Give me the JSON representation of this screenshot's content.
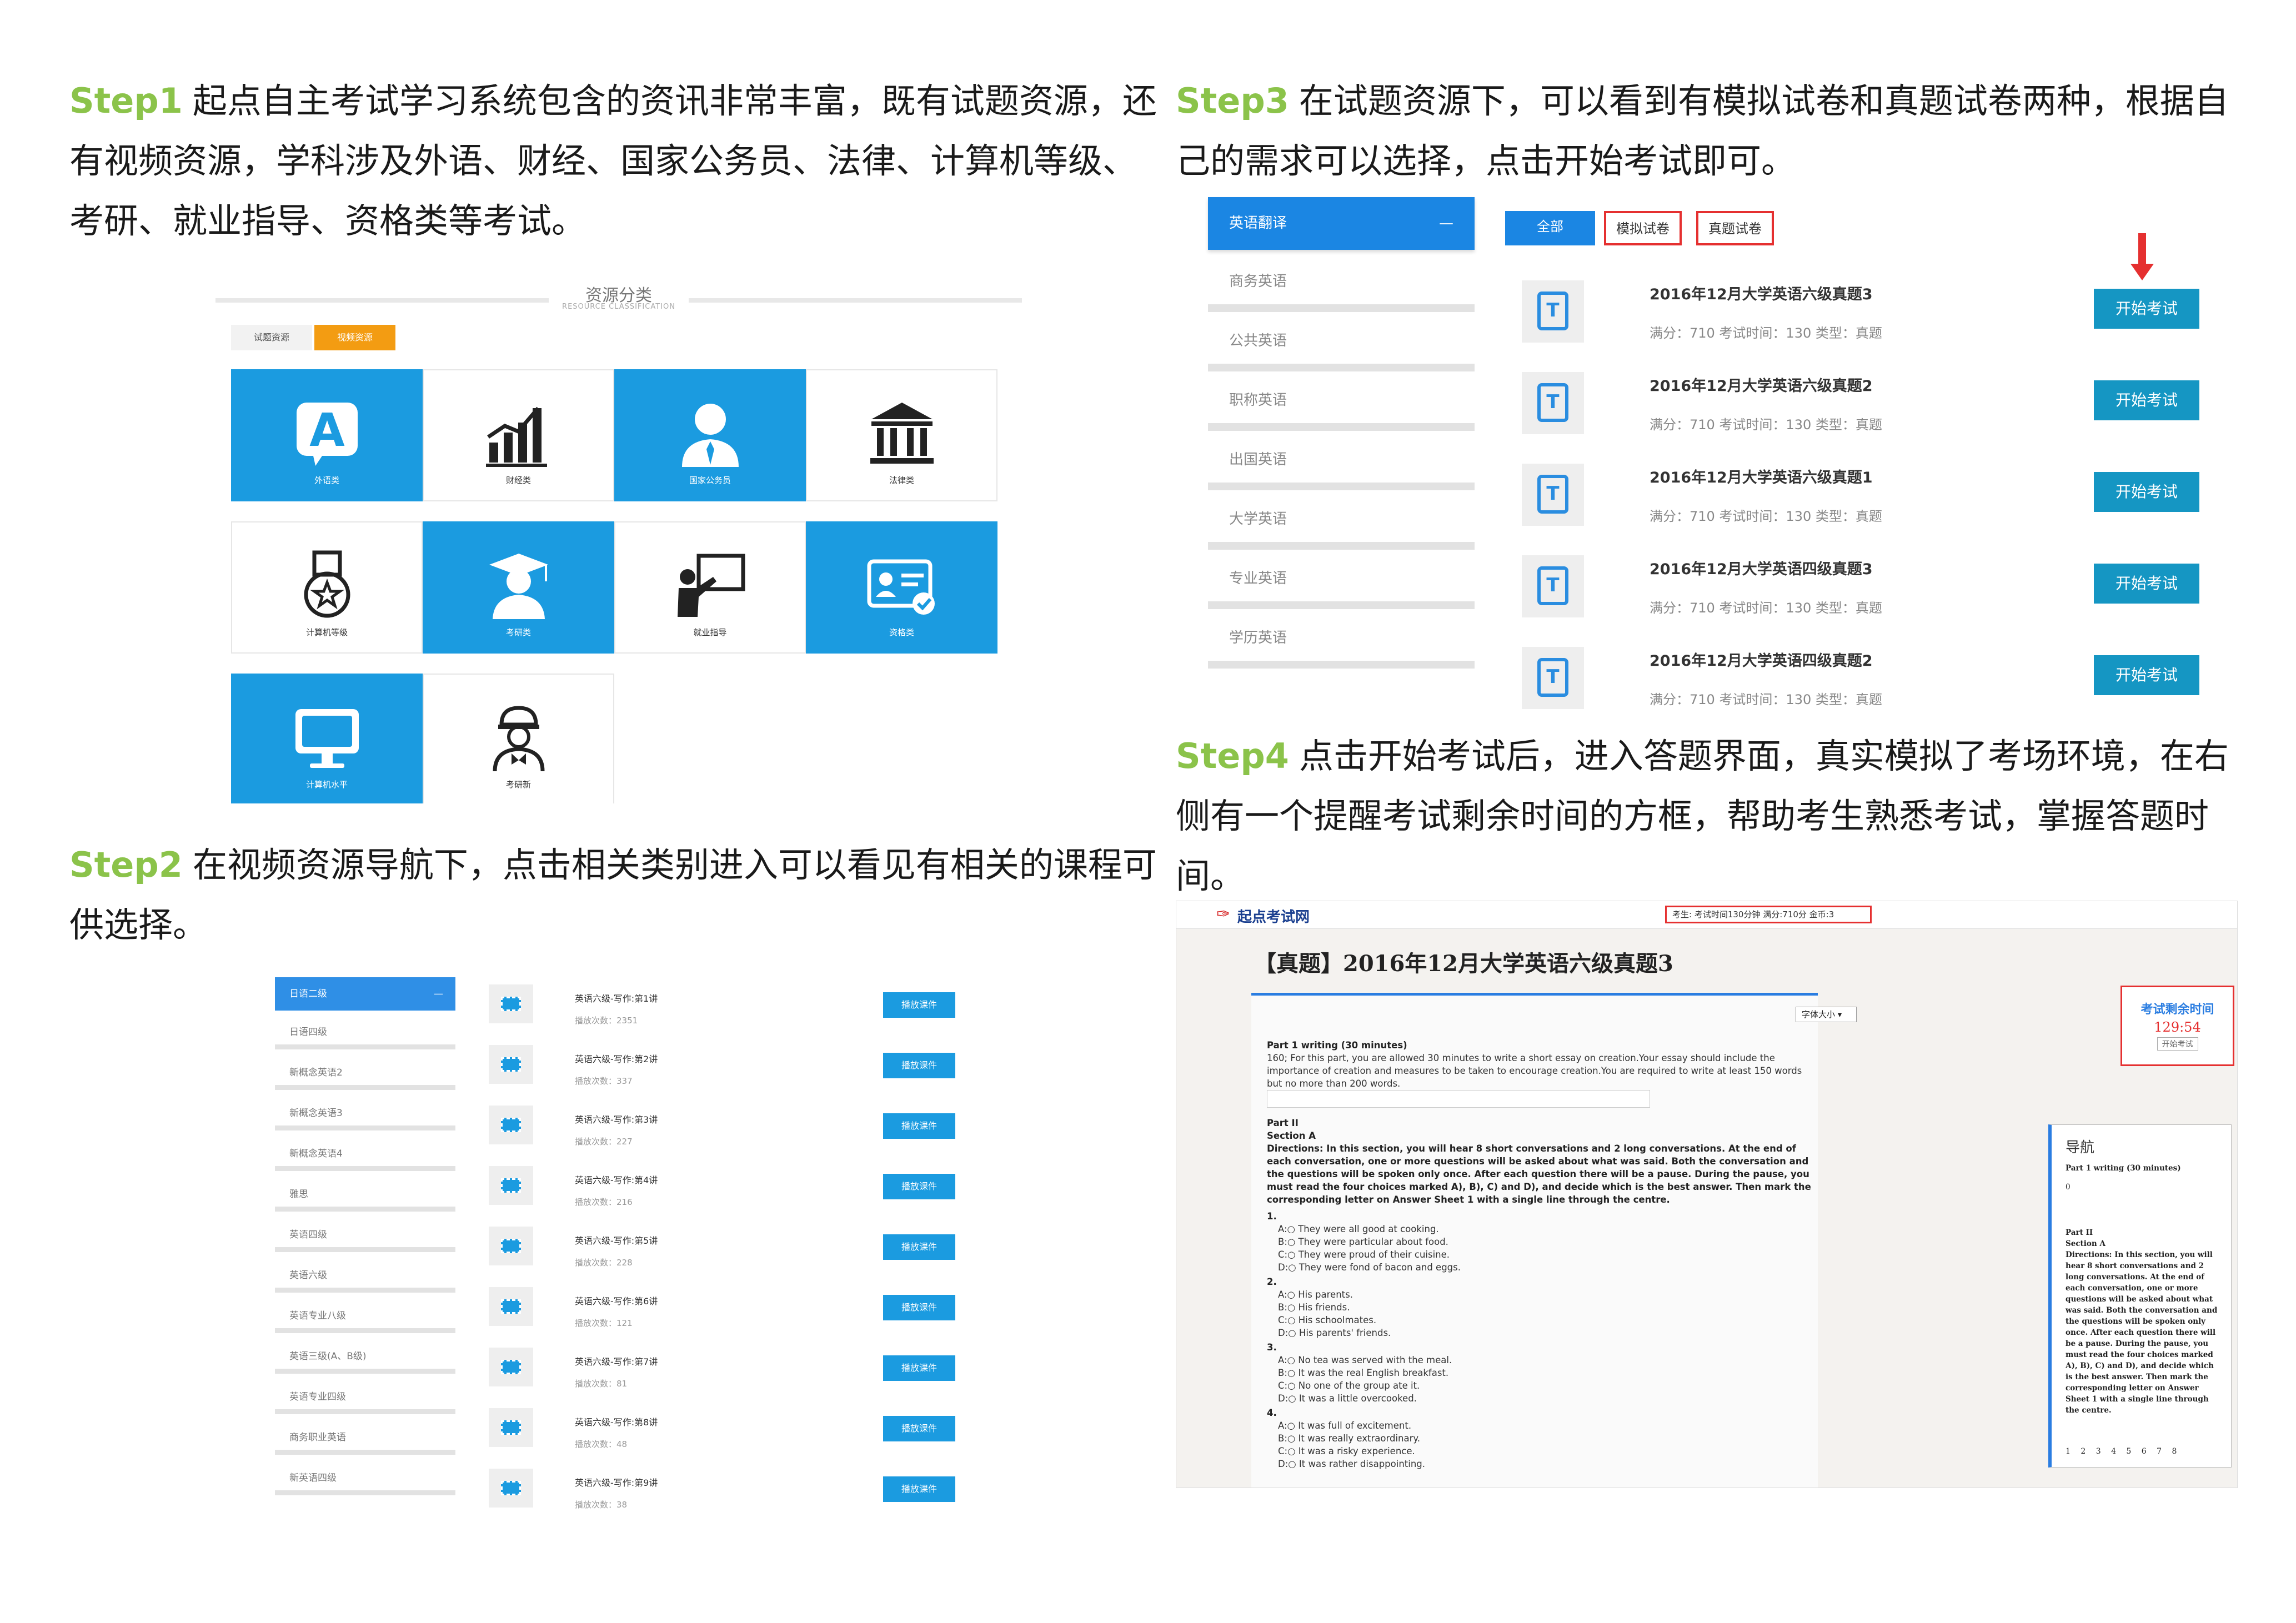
{
  "step1": {
    "step_label": "Step1",
    "text": "起点自主考试学习系统包含的资讯非常丰富，既有试题资源，还有视频资源，学科涉及外语、财经、国家公务员、法律、计算机等级、考研、就业指导、资格类等考试。",
    "panel": {
      "title": "资源分类",
      "subtitle": "RESOURCE CLASSIFICATION",
      "tab_exam": "试题资源",
      "tab_video": "视频资源",
      "tiles": [
        "外语类",
        "财经类",
        "国家公务员",
        "法律类",
        "计算机等级",
        "考研类",
        "就业指导",
        "资格类",
        "计算机水平",
        "考研新"
      ]
    }
  },
  "step2": {
    "step_label": "Step2",
    "text": "在视频资源导航下，点击相关类别进入可以看见有相关的课程可供选择。",
    "sidebar": [
      "日语二级",
      "日语四级",
      "新概念英语2",
      "新概念英语3",
      "新概念英语4",
      "雅思",
      "英语四级",
      "英语六级",
      "英语专业八级",
      "英语三级(A、B级)",
      "英语专业四级",
      "商务职业英语",
      "新英语四级"
    ],
    "collapse_symbol": "—",
    "play_label": "播放课件",
    "courses": [
      {
        "title": "英语六级-写作:第1讲",
        "plays": "播放次数：2351"
      },
      {
        "title": "英语六级-写作:第2讲",
        "plays": "播放次数：337"
      },
      {
        "title": "英语六级-写作:第3讲",
        "plays": "播放次数：227"
      },
      {
        "title": "英语六级-写作:第4讲",
        "plays": "播放次数：216"
      },
      {
        "title": "英语六级-写作:第5讲",
        "plays": "播放次数：228"
      },
      {
        "title": "英语六级-写作:第6讲",
        "plays": "播放次数：121"
      },
      {
        "title": "英语六级-写作:第7讲",
        "plays": "播放次数：81"
      },
      {
        "title": "英语六级-写作:第8讲",
        "plays": "播放次数：48"
      },
      {
        "title": "英语六级-写作:第9讲",
        "plays": "播放次数：38"
      }
    ]
  },
  "step3": {
    "step_label": "Step3",
    "text": "在试题资源下，可以看到有模拟试卷和真题试卷两种，根据自己的需求可以选择，点击开始考试即可。",
    "sidebar": [
      "英语翻译",
      "商务英语",
      "公共英语",
      "职称英语",
      "出国英语",
      "大学英语",
      "专业英语",
      "学历英语"
    ],
    "collapse_symbol": "—",
    "tabs": [
      "全部",
      "模拟试卷",
      "真题试卷"
    ],
    "start_label": "开始考试",
    "exams": [
      {
        "title": "2016年12月大学英语六级真题3",
        "meta": "满分：710   考试时间：130   类型：真题"
      },
      {
        "title": "2016年12月大学英语六级真题2",
        "meta": "满分：710   考试时间：130   类型：真题"
      },
      {
        "title": "2016年12月大学英语六级真题1",
        "meta": "满分：710   考试时间：130   类型：真题"
      },
      {
        "title": "2016年12月大学英语四级真题3",
        "meta": "满分：710   考试时间：130   类型：真题"
      },
      {
        "title": "2016年12月大学英语四级真题2",
        "meta": "满分：710   考试时间：130   类型：真题"
      }
    ]
  },
  "step4": {
    "step_label": "Step4",
    "text": "点击开始考试后，进入答题界面，真实模拟了考场环境，在右侧有一个提醒考试剩余时间的方框，帮助考生熟悉考试，掌握答题时间。",
    "screen": {
      "logo": "起点考试网",
      "info": "考生:    考试时间130分钟    满分:710分    金币:3",
      "paper_title": "【真题】2016年12月大学英语六级真题3",
      "font_size_label": "字体大小",
      "part1_head": "Part 1       writing       (30 minutes)",
      "part1_body": "160;  For this part, you are allowed 30 minutes to write a short essay on creation.Your essay should include the importance of creation and measures to be taken to encourage creation.You are required to write at least 150 words but no more than 200 words.",
      "part2_head": "Part II",
      "section": "Section A",
      "directions": "Directions: In this section, you will hear 8 short conversations and 2 long conversations. At the end of each conversation, one or more questions will be asked about what was said. Both the conversation and the questions will be spoken only once. After each question there will be a pause. During the pause, you must read the four choices marked A), B), C) and D), and decide which is the best answer. Then mark the corresponding letter on Answer Sheet 1 with a single line through the centre.",
      "questions": [
        {
          "num": "1.",
          "options": [
            "A:○  They were all good at cooking.",
            "B:○  They were particular about food.",
            "C:○  They were proud of their cuisine.",
            "D:○  They were fond of bacon and eggs."
          ]
        },
        {
          "num": "2.",
          "options": [
            "A:○  His parents.",
            "B:○  His friends.",
            "C:○  His schoolmates.",
            "D:○  His parents' friends."
          ]
        },
        {
          "num": "3.",
          "options": [
            "A:○  No tea was served with the meal.",
            "B:○  It was the real English breakfast.",
            "C:○  No one of the group ate it.",
            "D:○  It was a little overcooked."
          ]
        },
        {
          "num": "4.",
          "options": [
            "A:○  It was full of excitement.",
            "B:○  It was really extraordinary.",
            "C:○  It was a risky experience.",
            "D:○  It was rather disappointing."
          ]
        }
      ],
      "timer_title": "考试剩余时间",
      "timer_value": "129:54",
      "timer_button": "开始考试",
      "nav_title": "导航",
      "nav_part1": "Part 1       writing       (30 minutes)",
      "nav_zero": "0",
      "nav_part2": "Part II",
      "nav_section": "Section A",
      "nav_directions": "Directions: In this section, you will hear 8 short conversations and 2 long conversations. At the end of each conversation, one or more questions will be asked about what was said. Both the conversation and the questions will be spoken only once. After each question there will be a pause. During the pause, you must read the four choices marked A), B), C) and D), and decide which is the best answer. Then mark the corresponding letter on Answer Sheet 1 with a single line through the centre.",
      "nav_numbers": "1 2 3 4 5 6 7 8"
    }
  }
}
